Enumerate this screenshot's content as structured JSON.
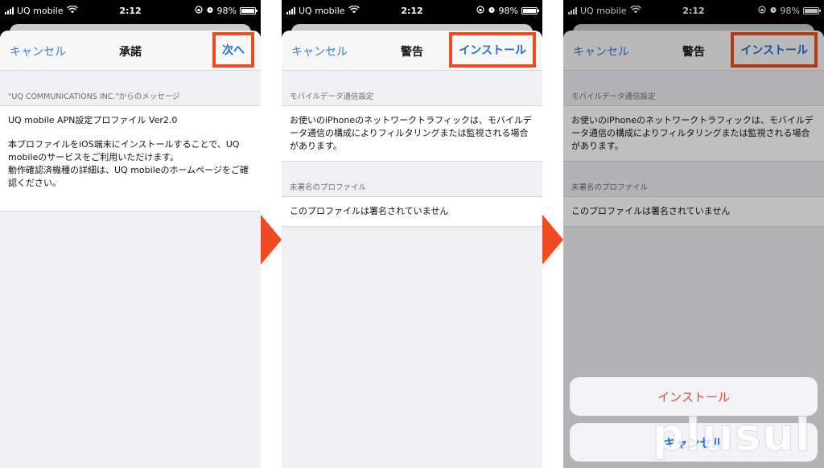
{
  "status_bar": {
    "carrier": "UQ mobile",
    "time": "2:12",
    "battery": "98%",
    "battery_level": 0.98
  },
  "colors": {
    "accent": "#1f6fd6",
    "highlight": "#f04a23",
    "destructive": "#e14a3a"
  },
  "screen1": {
    "nav": {
      "left": "キャンセル",
      "title": "承諾",
      "right": "次へ"
    },
    "section_header": "\"UQ COMMUNICATIONS INC.\"からのメッセージ",
    "cell_lines": [
      "UQ mobile APN設定プロファイル Ver2.0",
      "本プロファイルをiOS端末にインストールすることで、UQ mobileのサービスをご利用いただけます。",
      "動作確認済機種の詳細は、UQ mobileのホームページをご確認ください。"
    ]
  },
  "screen2": {
    "nav": {
      "left": "キャンセル",
      "title": "警告",
      "right": "インストール"
    },
    "section1_header": "モバイルデータ通信設定",
    "section1_text": "お使いのiPhoneのネットワークトラフィックは、モバイルデータ通信の構成によりフィルタリングまたは監視される場合があります。",
    "section2_header": "未署名のプロファイル",
    "section2_text": "このプロファイルは署名されていません"
  },
  "screen3": {
    "nav": {
      "left": "キャンセル",
      "title": "警告",
      "right": "インストール"
    },
    "section1_header": "モバイルデータ通信設定",
    "section1_text": "お使いのiPhoneのネットワークトラフィックは、モバイルデータ通信の構成によりフィルタリングまたは監視される場合があります。",
    "section2_header": "未署名のプロファイル",
    "section2_text": "このプロファイルは署名されていません",
    "action_install": "インストール",
    "action_cancel": "キャンセル"
  },
  "watermark": "plusul"
}
